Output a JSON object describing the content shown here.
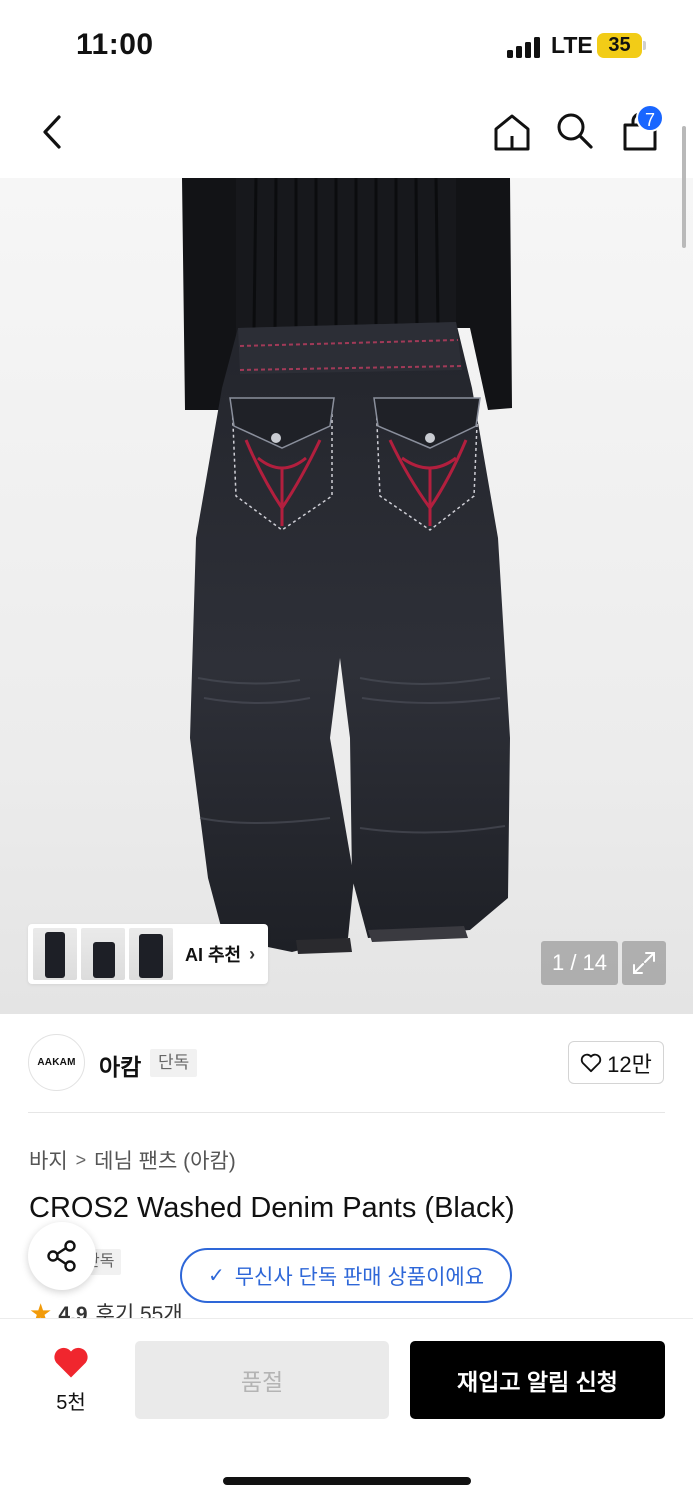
{
  "status_bar": {
    "time": "11:00",
    "network": "LTE",
    "battery": "35"
  },
  "nav": {
    "cart_count": "7"
  },
  "gallery": {
    "ai_recommend_label": "AI 추천",
    "page_counter": "1 / 14"
  },
  "brand": {
    "logo_text": "AAKAM",
    "name": "아캄",
    "tag": "단독",
    "likes": "12만"
  },
  "product": {
    "breadcrumb": [
      "바지",
      "데님 팬츠 (아캄)"
    ],
    "title": "CROS2 Washed Denim Pants (Black)",
    "exclusive_tag": "단독",
    "exclusive_notice": "무신사 단독 판매 상품이에요",
    "rating": "4.9",
    "reviews": "후기 55개"
  },
  "actions": {
    "wish_count": "5천",
    "soldout_label": "품절",
    "restock_label": "재입고 알림 신청"
  },
  "colors": {
    "accent_blue": "#2e67d8",
    "badge_blue": "#1966ff",
    "heart_red": "#f0262e",
    "star_orange": "#f29b0a",
    "battery_yellow": "#f2cc17"
  }
}
